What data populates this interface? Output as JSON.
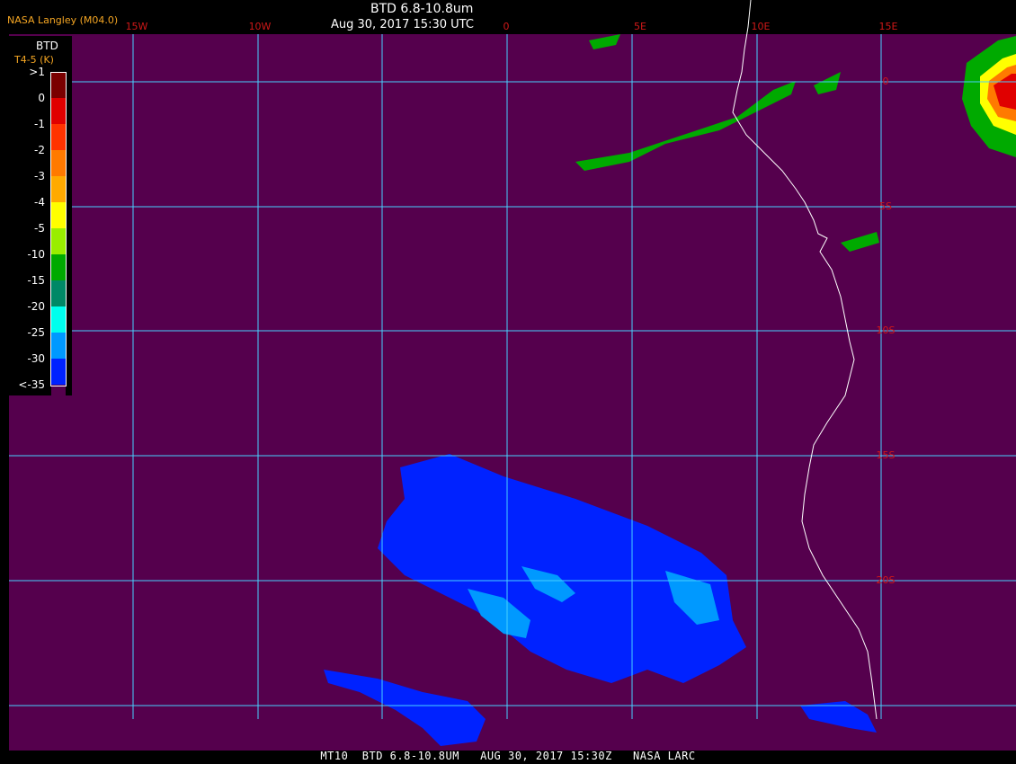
{
  "header": {
    "org_label": "NASA Langley (M04.0)",
    "title": "BTD 6.8-10.8um",
    "datetime": "Aug 30, 2017 15:30 UTC"
  },
  "footer": {
    "text": "MT10  BTD 6.8-10.8UM   AUG 30, 2017 15:30Z   NASA LARC"
  },
  "legend": {
    "title": "BTD",
    "subtitle": "T4-5 (K)",
    "labels": [
      ">1",
      "0",
      "-1",
      "-2",
      "-3",
      "-4",
      "-5",
      "-10",
      "-15",
      "-20",
      "-25",
      "-30",
      "<-35"
    ],
    "colors": [
      "#7a0000",
      "#e00000",
      "#ff3300",
      "#ff7a00",
      "#ffaa00",
      "#ffff00",
      "#99ee00",
      "#00aa00",
      "#008866",
      "#00ffee",
      "#0099ff",
      "#0022ff",
      "#55004d"
    ]
  },
  "map": {
    "background": "#55004d",
    "grid_color": "#48d1ff",
    "lon_labels": [
      "15W",
      "10W",
      "0",
      "5E",
      "10E",
      "15E"
    ],
    "lat_labels": [
      "0",
      "5S",
      "10S",
      "15S",
      "20S"
    ],
    "coast_color": "#ffffff"
  }
}
